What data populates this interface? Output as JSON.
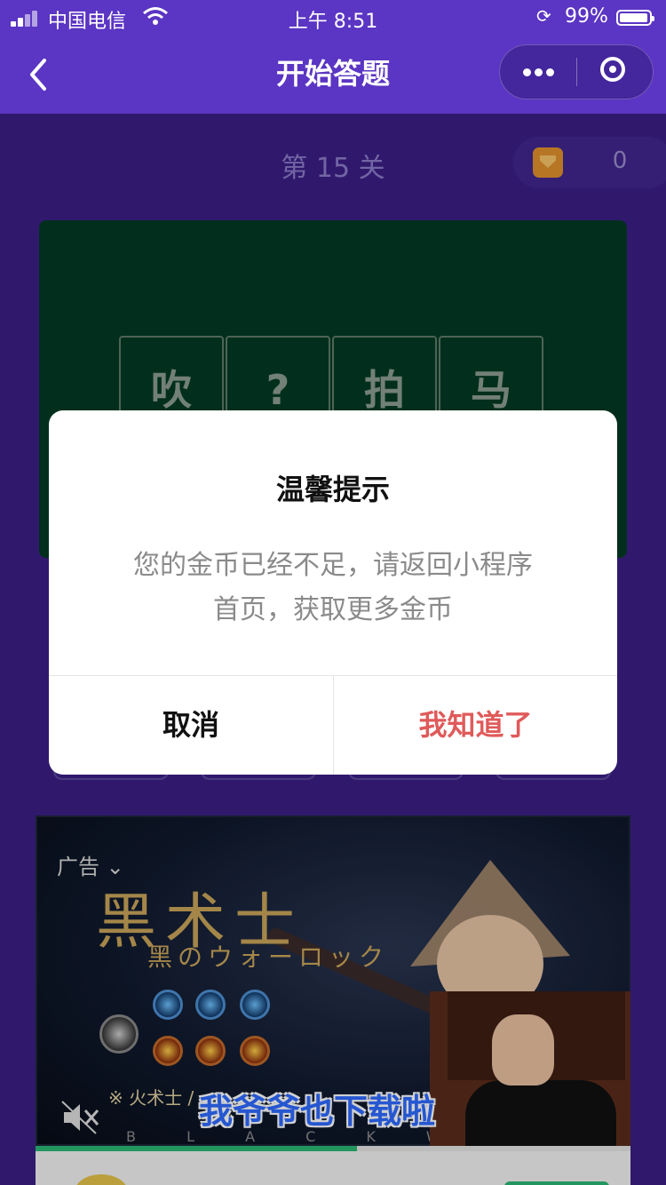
{
  "status_bar": {
    "carrier": "中国电信",
    "time": "上午 8:51",
    "battery": "99%",
    "icons": [
      "signal-icon",
      "wifi-icon",
      "orientation-lock-icon",
      "battery-icon"
    ]
  },
  "nav": {
    "title": "开始答题",
    "icons": [
      "back-arrow-icon",
      "more-dots-icon",
      "close-circle-icon"
    ]
  },
  "game": {
    "level_label": "第 15 关",
    "coin_count": "0",
    "coin_icon": "gem-icon",
    "tiles": [
      "吹",
      "?",
      "拍",
      "马"
    ]
  },
  "ad": {
    "label": "广告",
    "title": "黑术士",
    "subtitle": "黑のウォーロック",
    "class_text": "※ 火术士 / ",
    "footer_letters": "B L A C K W A R L",
    "caption": "我爷爷也下载啦",
    "progress": 0.54,
    "icons": [
      "chevron-down-icon",
      "mute-icon"
    ]
  },
  "modal": {
    "title": "温馨提示",
    "message_line1": "您的金币已经不足，请返回小程序",
    "message_line2": "首页，获取更多金币",
    "cancel_label": "取消",
    "ok_label": "我知道了"
  },
  "colors": {
    "header": "#5b35c3",
    "background": "#3b1f86",
    "board": "#033a24",
    "ok_text": "#e05a5a",
    "progress": "#2bb673"
  }
}
